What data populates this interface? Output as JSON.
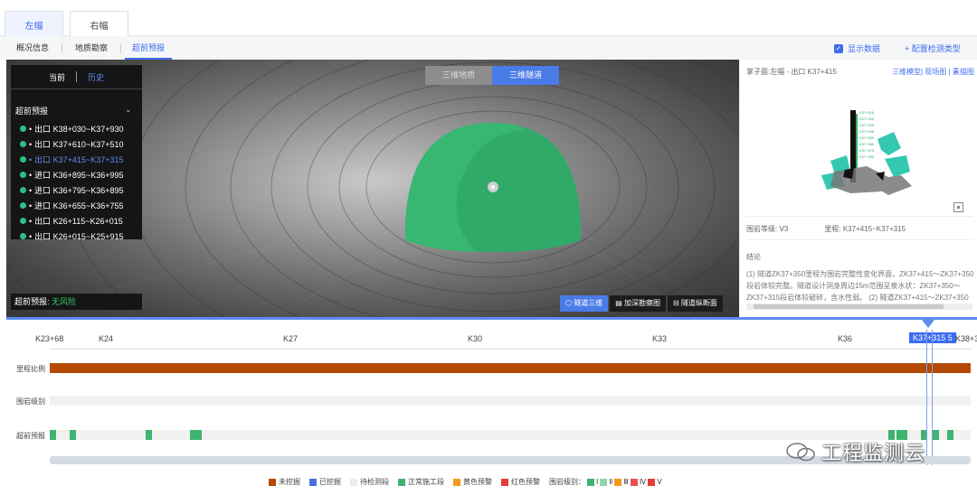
{
  "top_tabs": [
    {
      "label": "左幅",
      "active": true
    },
    {
      "label": "右幅",
      "active": false
    }
  ],
  "sub_tabs": [
    {
      "label": "概况信息"
    },
    {
      "label": "地质勘察"
    },
    {
      "label": "超前预报",
      "active": true
    }
  ],
  "show_data_label": "显示数据",
  "config_label": "+ 配置检测类型",
  "mode_switch": [
    {
      "label": "三维地质"
    },
    {
      "label": "三维隧道",
      "active": true
    }
  ],
  "selector": {
    "current": "当前",
    "history": "历史",
    "title": "超前预报",
    "chevron": "⌄",
    "items": [
      {
        "label": "出口 K38+030~K37+930"
      },
      {
        "label": "出口 K37+610~K37+510"
      },
      {
        "label": "出口 K37+415~K37+315",
        "active": true
      },
      {
        "label": "进口 K36+895~K36+995"
      },
      {
        "label": "进口 K36+795~K36+895"
      },
      {
        "label": "进口 K36+655~K36+755"
      },
      {
        "label": "出口 K26+115~K26+015"
      },
      {
        "label": "出口 K26+015~K25+915"
      }
    ]
  },
  "risk": {
    "label": "超前预报:",
    "value": "无风险"
  },
  "view_buttons": [
    {
      "label": "⬡ 隧道三维",
      "active": true
    },
    {
      "label": "▤ 加深勘察图"
    },
    {
      "label": "⊟ 隧道纵断面"
    }
  ],
  "right_panel": {
    "face": "掌子面:左幅 - 出口 K37+415",
    "links": "三维模型| 现场图 | 素描图",
    "grade": "围岩等级: Ⅴ3",
    "mileage": "里程: K37+415~K37+315",
    "conclusion_title": "结论",
    "conclusion": "(1) 隧道ZK37+350里程为围岩完整性变化界面，ZK37+415～ZK37+350段岩体较完整。隧道设计洞身周边15m范围呈泉水状：ZK37+350～ZK37+315段岩体较破碎，含水性弱。 (2) 隧道ZK37+415～ZK37+350"
  },
  "timeline": {
    "ticks": [
      "K23+68",
      "K24",
      "K27",
      "K30",
      "K33",
      "K36",
      "K37+315 5",
      "K38+3"
    ],
    "rows": [
      "里程比例",
      "围岩级别",
      "超前预报"
    ],
    "forecast_segments_km": [
      [
        23.68,
        23.78
      ],
      [
        24.0,
        24.08
      ],
      [
        25.2,
        25.3
      ],
      [
        25.9,
        26.09
      ],
      [
        37.0,
        37.1
      ],
      [
        37.12,
        37.3
      ],
      [
        37.51,
        37.61
      ],
      [
        37.7,
        37.8
      ],
      [
        37.93,
        38.03
      ]
    ],
    "km_range": [
      23.68,
      38.3
    ]
  },
  "legend": {
    "items": [
      {
        "label": "未挖掘",
        "color": "#b44a05"
      },
      {
        "label": "已挖掘",
        "color": "#4a6fd8"
      },
      {
        "label": "待检测段",
        "color": "#ececec"
      },
      {
        "label": "正常施工段",
        "color": "#3fb370"
      },
      {
        "label": "黄色预警",
        "color": "#f29a1c"
      },
      {
        "label": "红色预警",
        "color": "#e63b3b"
      }
    ],
    "grade_label": "围岩级别：",
    "grades": [
      {
        "label": "Ⅰ",
        "color": "#3fb370"
      },
      {
        "label": "Ⅱ",
        "color": "#8fd6a6"
      },
      {
        "label": "Ⅲ",
        "color": "#f29a1c"
      },
      {
        "label": "Ⅳ",
        "color": "#e65050"
      },
      {
        "label": "Ⅴ",
        "color": "#e63b3b"
      }
    ]
  },
  "watermark": "工程监测云",
  "model_labels": [
    "K37+315",
    "K37+325",
    "K37+335",
    "K37+345",
    "K37+355",
    "K37+365",
    "K37+375",
    "K37+385"
  ]
}
